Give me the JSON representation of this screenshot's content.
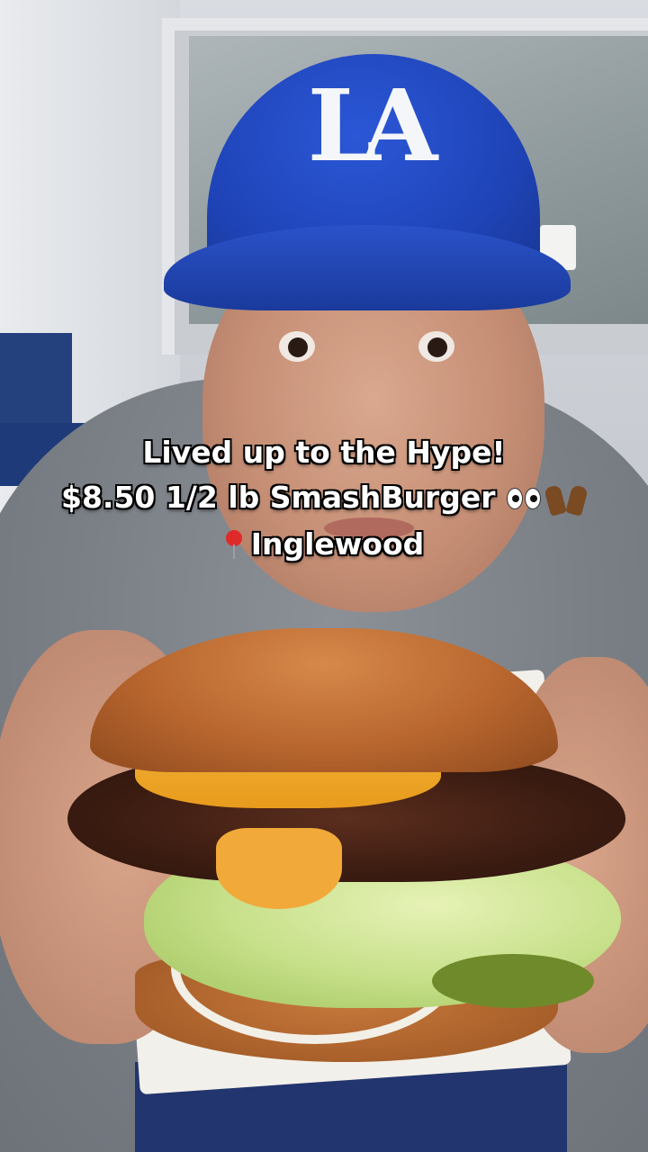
{
  "caption": {
    "line1": "Lived up to the Hype!",
    "line2": "$8.50 1/2 lb SmashBurger",
    "line3": "Inglewood"
  },
  "icons": {
    "line2_emojis": [
      "eyes-emoji-icon",
      "raised-hands-emoji-icon"
    ],
    "line3_emoji": "round-pushpin-emoji-icon"
  },
  "cap_logo": "LA",
  "colors": {
    "cap_blue": "#1f44b8",
    "caption_text": "#ffffff",
    "caption_outline": "#000000",
    "cheese": "#f3b23a"
  }
}
